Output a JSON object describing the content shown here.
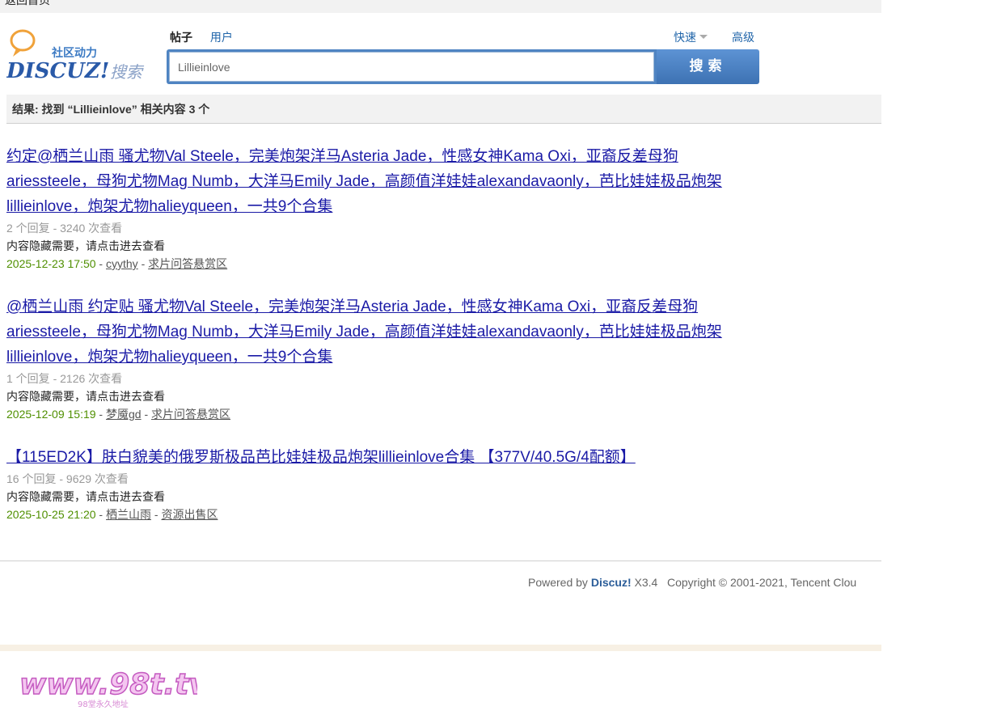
{
  "topbar": {
    "back_label": "返回首页"
  },
  "logo": {
    "tagline": "社区动力",
    "brand": "DISCUZ!",
    "suffix": "搜索"
  },
  "tabs": [
    {
      "label": "帖子",
      "active": true
    },
    {
      "label": "用户",
      "active": false
    }
  ],
  "quick_label": "快速",
  "advanced_label": "高级",
  "search": {
    "value": "Lillieinlove",
    "button_label": "搜索"
  },
  "result_summary": "结果: 找到 “Lillieinlove” 相关内容 3 个",
  "results": [
    {
      "title": "约定@栖兰山雨 骚尤物Val Steele，完美炮架洋马Asteria Jade，性感女神Kama Oxi，亚裔反差母狗ariessteele，母狗尤物Mag Numb，大洋马Emily Jade，高颜值洋娃娃alexandavaonly，芭比娃娃极品炮架lillieinlove，炮架尤物halieyqueen，一共9个合集",
      "meta": "2 个回复 - 3240 次查看",
      "desc": "内容隐藏需要，请点击进去查看",
      "date": "2025-12-23 17:50",
      "author": "cyythy",
      "forum": "求片问答悬赏区"
    },
    {
      "title": "@栖兰山雨 约定贴 骚尤物Val Steele，完美炮架洋马Asteria Jade，性感女神Kama Oxi，亚裔反差母狗ariessteele，母狗尤物Mag Numb，大洋马Emily Jade，高颜值洋娃娃alexandavaonly，芭比娃娃极品炮架lillieinlove，炮架尤物halieyqueen，一共9个合集",
      "meta": "1 个回复 - 2126 次查看",
      "desc": "内容隐藏需要，请点击进去查看",
      "date": "2025-12-09 15:19",
      "author": "梦魇gd",
      "forum": "求片问答悬赏区"
    },
    {
      "title": "【115ED2K】肤白貌美的俄罗斯极品芭比娃娃极品炮架lillieinlove合集 【377V/40.5G/4配额】",
      "meta": "16 个回复 - 9629 次查看",
      "desc": "内容隐藏需要，请点击进去查看",
      "date": "2025-10-25 21:20",
      "author": "栖兰山雨",
      "forum": "资源出售区"
    }
  ],
  "footer": {
    "powered": "Powered by",
    "brand": "Discuz!",
    "version": "X3.4",
    "copyright": "Copyright © 2001-2021, Tencent Clou"
  },
  "watermark": {
    "text": "www.98t.tv",
    "sub": "98堂永久地址"
  },
  "colors": {
    "link": "#1a1aa6",
    "accent": "#4f84c2",
    "date": "#4f8f00",
    "brand": "#2b5d99"
  }
}
